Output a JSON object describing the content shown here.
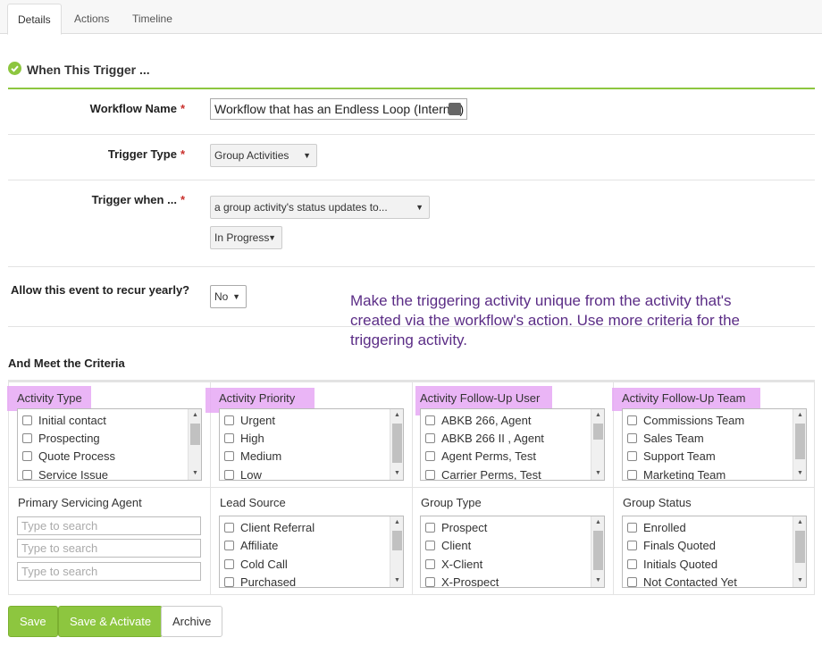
{
  "tabs": [
    {
      "label": "Details"
    },
    {
      "label": "Actions"
    },
    {
      "label": "Timeline"
    }
  ],
  "section": {
    "title": "When This Trigger ..."
  },
  "fields": {
    "workflow_name": {
      "label": "Workflow Name",
      "required": "*",
      "value": "Workflow that has an Endless Loop (Internal)"
    },
    "trigger_type": {
      "label": "Trigger Type",
      "required": "*",
      "value": "Group Activities"
    },
    "trigger_when": {
      "label": "Trigger when ...",
      "required": "*",
      "value": "a group activity's status updates to...",
      "status_value": "In Progress"
    },
    "recur": {
      "label": "Allow this event to recur yearly?",
      "value": "No"
    }
  },
  "note": "Make the triggering activity unique from the activity that's created via the workflow's action. Use more criteria for the triggering activity.",
  "criteria": {
    "title": "And Meet the Criteria",
    "cells": [
      {
        "title": "Activity Type",
        "items": [
          "Initial contact",
          "Prospecting",
          "Quote Process",
          "Service Issue"
        ]
      },
      {
        "title": "Activity Priority",
        "items": [
          "Urgent",
          "High",
          "Medium",
          "Low"
        ]
      },
      {
        "title": "Activity Follow-Up User",
        "items": [
          "ABKB 266, Agent",
          "ABKB 266 II , Agent",
          "Agent Perms, Test",
          "Carrier Perms, Test"
        ]
      },
      {
        "title": "Activity Follow-Up Team",
        "items": [
          "Commissions Team",
          "Sales Team",
          "Support Team",
          "Marketing Team"
        ]
      },
      {
        "title": "Primary Servicing Agent",
        "search_placeholder": "Type to search"
      },
      {
        "title": "Lead Source",
        "items": [
          "Client Referral",
          "Affiliate",
          "Cold Call",
          "Purchased"
        ]
      },
      {
        "title": "Group Type",
        "items": [
          "Prospect",
          "Client",
          "X-Client",
          "X-Prospect"
        ]
      },
      {
        "title": "Group Status",
        "items": [
          "Enrolled",
          "Finals Quoted",
          "Initials Quoted",
          "Not Contacted Yet"
        ]
      }
    ]
  },
  "buttons": {
    "save": "Save",
    "save_activate": "Save & Activate",
    "archive": "Archive"
  },
  "colors": {
    "accent": "#8dc63f",
    "highlight": "#e6a8f5",
    "note": "#5b2d86",
    "required": "#c9302c"
  }
}
